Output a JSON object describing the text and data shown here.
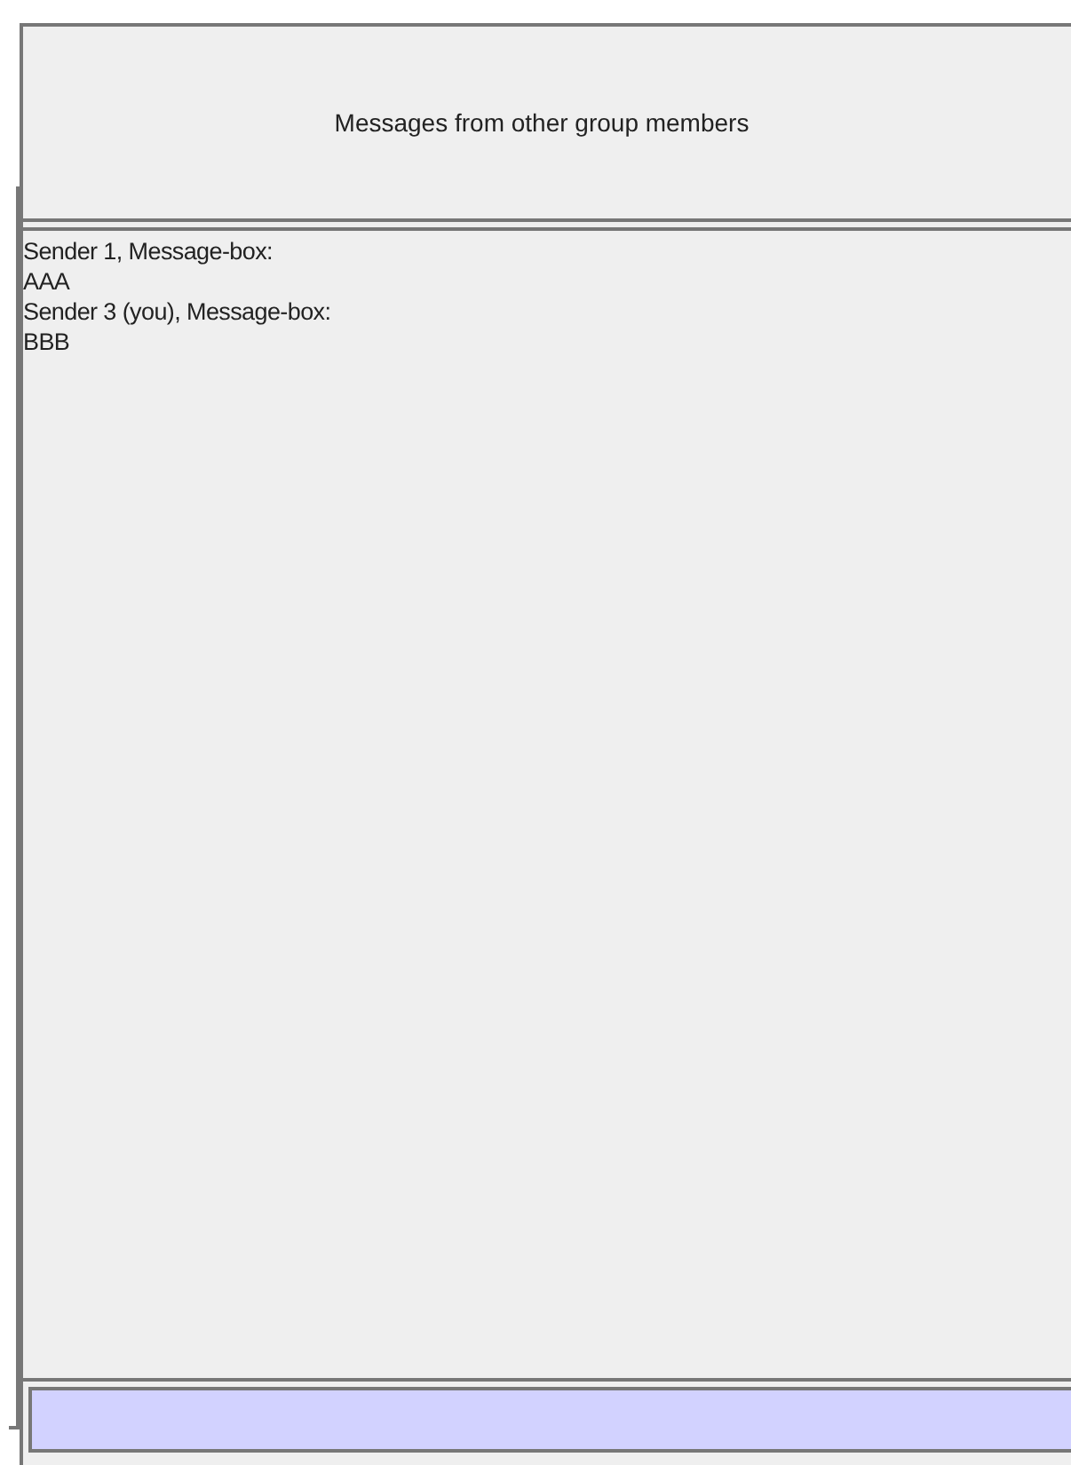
{
  "header": {
    "title": "Messages from other group members"
  },
  "messages": [
    {
      "sender": "Sender 1, Message-box:",
      "text": "AAA"
    },
    {
      "sender": "Sender 3 (you), Message-box:",
      "text": "BBB"
    }
  ]
}
